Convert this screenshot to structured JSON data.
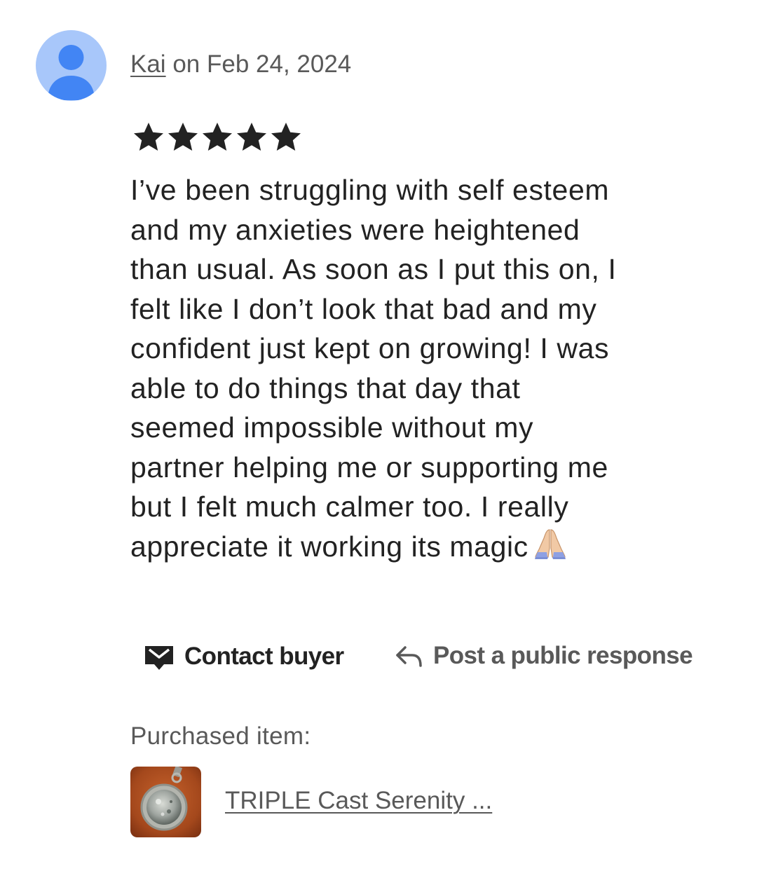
{
  "review": {
    "reviewer_name": "Kai",
    "date_text": " on Feb 24, 2024",
    "rating": 5,
    "rating_max": 5,
    "text_lines": [
      "I’ve been struggling with self esteem",
      "and my anxieties were heightened",
      "than usual. As soon as I put this on, I",
      "felt like I don’t look that bad and my",
      "confident just kept on growing! I was",
      "able to do things that day that",
      "seemed impossible without my",
      "partner helping me or supporting me",
      "but I felt much calmer too. I really",
      "appreciate it working its magic"
    ],
    "emoji": "folded-hands-emoji"
  },
  "actions": {
    "contact_label": "Contact buyer",
    "contact_icon": "mail-icon",
    "public_response_label": "Post a public response",
    "public_response_icon": "reply-arrow-icon"
  },
  "purchase": {
    "label": "Purchased item:",
    "item_title": "TRIPLE Cast Serenity ...",
    "thumbnail": "pendant-thumbnail"
  },
  "colors": {
    "avatar_bg": "#a8c7fa",
    "avatar_fg": "#4285f4",
    "text_primary": "#222222",
    "text_secondary": "#595959",
    "star": "#222222"
  }
}
